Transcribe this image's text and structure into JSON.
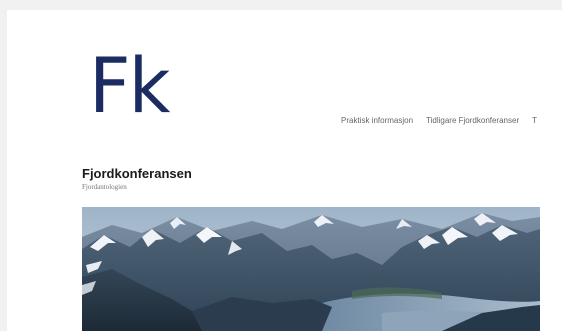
{
  "header": {
    "logo_text": "Fk",
    "nav_items": [
      {
        "label": "Praktisk informasjon"
      },
      {
        "label": "Tidligare Fjordkonferanser"
      },
      {
        "label": "T"
      }
    ]
  },
  "site": {
    "title": "Fjordkonferansen",
    "tagline": "Fjordantologien"
  },
  "colors": {
    "logo": "#1b2c63",
    "background": "#f1f1f1",
    "page": "#ffffff"
  }
}
